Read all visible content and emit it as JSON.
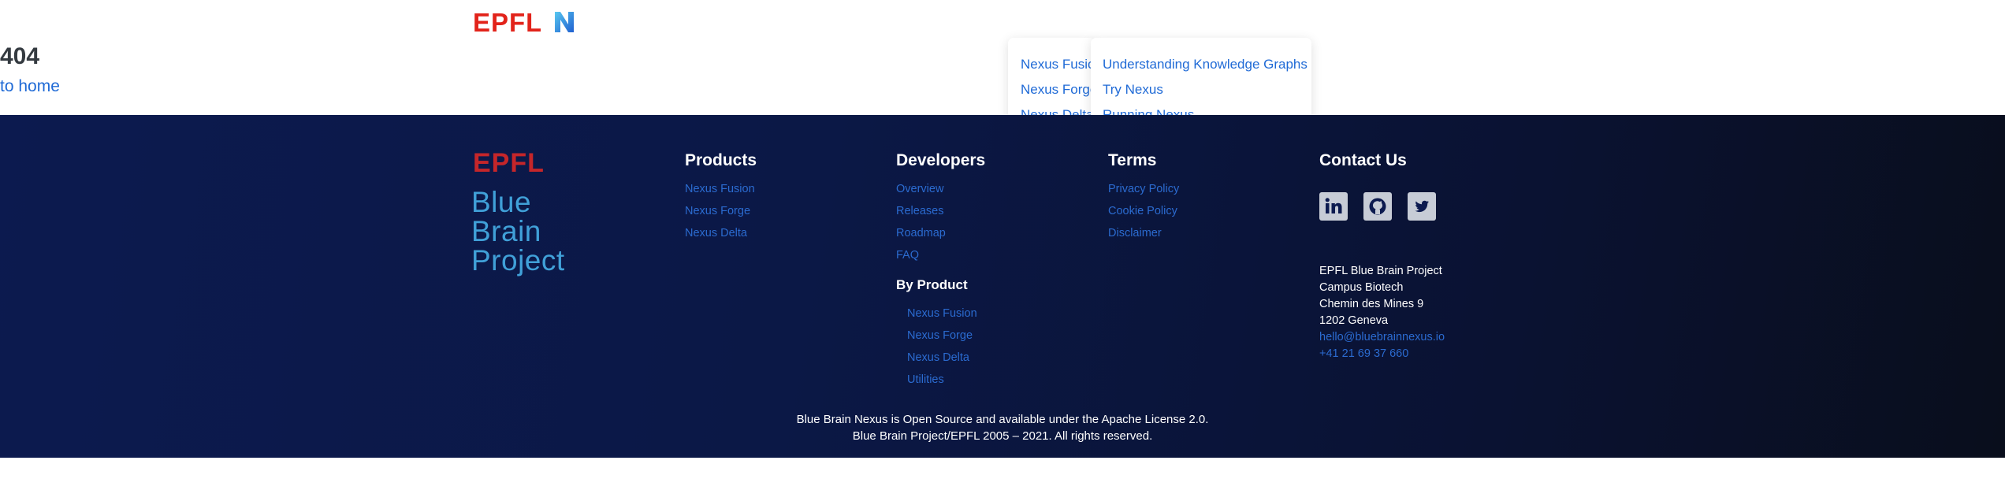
{
  "header": {
    "epfl_logo_text": "EPFL",
    "nexus_logo_text": "N"
  },
  "error": {
    "code": "404",
    "home_link": "to home"
  },
  "dropdown_products": {
    "items": [
      "Nexus Fusion",
      "Nexus Forge",
      "Nexus Delta"
    ]
  },
  "dropdown_resources": {
    "items": [
      "Understanding Knowledge Graphs",
      "Try Nexus",
      "Running Nexus"
    ]
  },
  "footer": {
    "logo_epfl": "EPFL",
    "logo_bbp": [
      "Blue",
      "Brain",
      "Project"
    ],
    "products": {
      "title": "Products",
      "links": [
        "Nexus Fusion",
        "Nexus Forge",
        "Nexus Delta"
      ]
    },
    "developers": {
      "title": "Developers",
      "links": [
        "Overview",
        "Releases",
        "Roadmap",
        "FAQ"
      ],
      "by_product_title": "By Product",
      "by_product_links": [
        "Nexus Fusion",
        "Nexus Forge",
        "Nexus Delta",
        "Utilities"
      ]
    },
    "terms": {
      "title": "Terms",
      "links": [
        "Privacy Policy",
        "Cookie Policy",
        "Disclaimer"
      ]
    },
    "contact": {
      "title": "Contact Us",
      "social_icons": [
        "linkedin-icon",
        "github-icon",
        "twitter-icon"
      ],
      "address": [
        "EPFL Blue Brain Project",
        "Campus Biotech",
        "Chemin des Mines 9",
        "1202 Geneva"
      ],
      "email": "hello@bluebrainnexus.io",
      "phone": "+41 21 69 37 660"
    },
    "license": "Blue Brain Nexus is Open Source and available under the Apache License 2.0.",
    "copyright": "Blue Brain Project/EPFL 2005 – 2021. All rights reserved."
  },
  "colors": {
    "link": "#1f6ad6",
    "epfl_red": "#e2231a",
    "footer_bg": "#0c1a4f",
    "bbp_blue": "#40a0d8"
  }
}
